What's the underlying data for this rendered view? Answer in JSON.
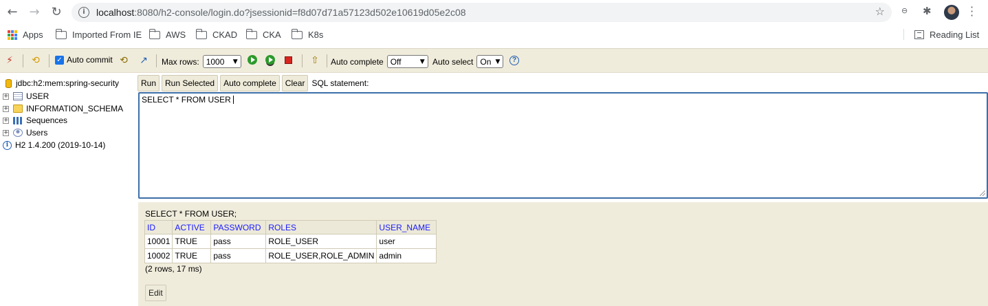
{
  "browser": {
    "url_host": "localhost",
    "url_rest": ":8080/h2-console/login.do?jsessionid=f8d07d71a57123d502e10619d05e2c08",
    "bookmarks": [
      "Apps",
      "Imported From IE",
      "AWS",
      "CKAD",
      "CKA",
      "K8s"
    ],
    "reading_list": "Reading List",
    "icons": [
      "back-icon",
      "forward-icon",
      "reload-icon",
      "info-icon",
      "star-icon",
      "extension-icon",
      "puzzle-icon",
      "avatar",
      "menu-icon"
    ]
  },
  "toolbar": {
    "auto_commit": "Auto commit",
    "auto_commit_checked": true,
    "max_rows_label": "Max rows:",
    "max_rows_value": "1000",
    "auto_complete_label": "Auto complete",
    "auto_complete_value": "Off",
    "auto_select_label": "Auto select",
    "auto_select_value": "On",
    "help": "?"
  },
  "tree": {
    "connection": "jdbc:h2:mem:spring-security",
    "items": [
      "USER",
      "INFORMATION_SCHEMA",
      "Sequences",
      "Users"
    ],
    "version": "H2 1.4.200 (2019-10-14)"
  },
  "query": {
    "buttons": [
      "Run",
      "Run Selected",
      "Auto complete",
      "Clear"
    ],
    "label": "SQL statement:",
    "sql": "SELECT * FROM USER"
  },
  "results": {
    "statement": "SELECT * FROM USER;",
    "columns": [
      "ID",
      "ACTIVE",
      "PASSWORD",
      "ROLES",
      "USER_NAME"
    ],
    "rows": [
      [
        "10001",
        "TRUE",
        "pass",
        "ROLE_USER",
        "user"
      ],
      [
        "10002",
        "TRUE",
        "pass",
        "ROLE_USER,ROLE_ADMIN",
        "admin"
      ]
    ],
    "summary": "(2 rows, 17 ms)",
    "edit": "Edit"
  },
  "colors": {
    "toolbar_bg": "#f0ecdc",
    "header_link": "#1a1aff",
    "editor_border": "#3d6fa8"
  }
}
